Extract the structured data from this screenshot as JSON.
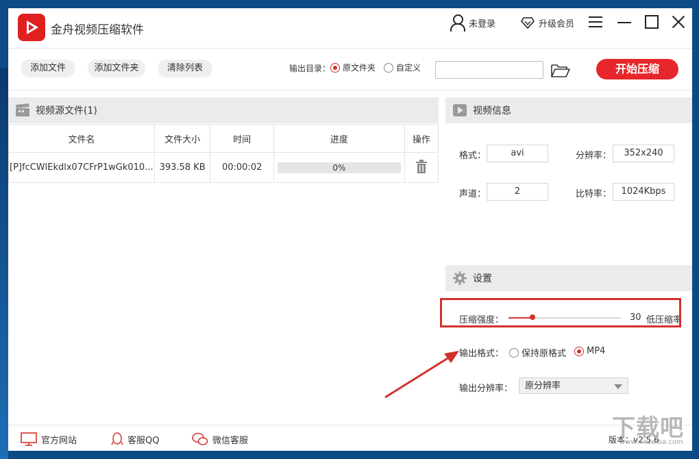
{
  "app": {
    "title": "金舟视频压缩软件"
  },
  "topbar": {
    "login": "未登录",
    "upgrade": "升级会员"
  },
  "toolbar": {
    "add_file": "添加文件",
    "add_folder": "添加文件夹",
    "clear_list": "清除列表",
    "output_dir_label": "输出目录：",
    "opt_source_folder": "原文件夹",
    "opt_custom": "自定义",
    "output_dir_selected": "原文件夹",
    "path_value": "",
    "start": "开始压缩"
  },
  "source_panel": {
    "title": "视频源文件(1)",
    "columns": [
      "文件名",
      "文件大小",
      "时间",
      "进度",
      "操作"
    ],
    "rows": [
      {
        "name": "[P]fcCWlEkdlx07CFrP1wGk010...",
        "size": "393.58 KB",
        "time": "00:00:02",
        "progress": 0,
        "progress_text": "0%"
      }
    ]
  },
  "video_info": {
    "title": "视频信息",
    "format_label": "格式：",
    "format_value": "avi",
    "resolution_label": "分辨率：",
    "resolution_value": "352x240",
    "channel_label": "声道：",
    "channel_value": "2",
    "bitrate_label": "比特率：",
    "bitrate_value": "1024Kbps"
  },
  "settings": {
    "title": "设置",
    "strength_label": "压缩强度：",
    "strength_value": "30",
    "strength_fraction": 0.3,
    "strength_hint": "低压缩率",
    "format_label": "输出格式：",
    "opt_keep": "保持原格式",
    "opt_mp4": "MP4",
    "format_selected": "MP4",
    "res_label": "输出分辨率：",
    "res_value": "原分辨率"
  },
  "footer": {
    "website": "官方网站",
    "qq": "客服QQ",
    "wechat": "微信客服",
    "version": "版本：v2.5.6"
  },
  "watermark": {
    "text": "下载吧",
    "url": "www.xiazaiba.com"
  },
  "colors": {
    "accent": "#e6262b",
    "highlight": "#d4302a",
    "panel_header": "#ebebeb"
  }
}
